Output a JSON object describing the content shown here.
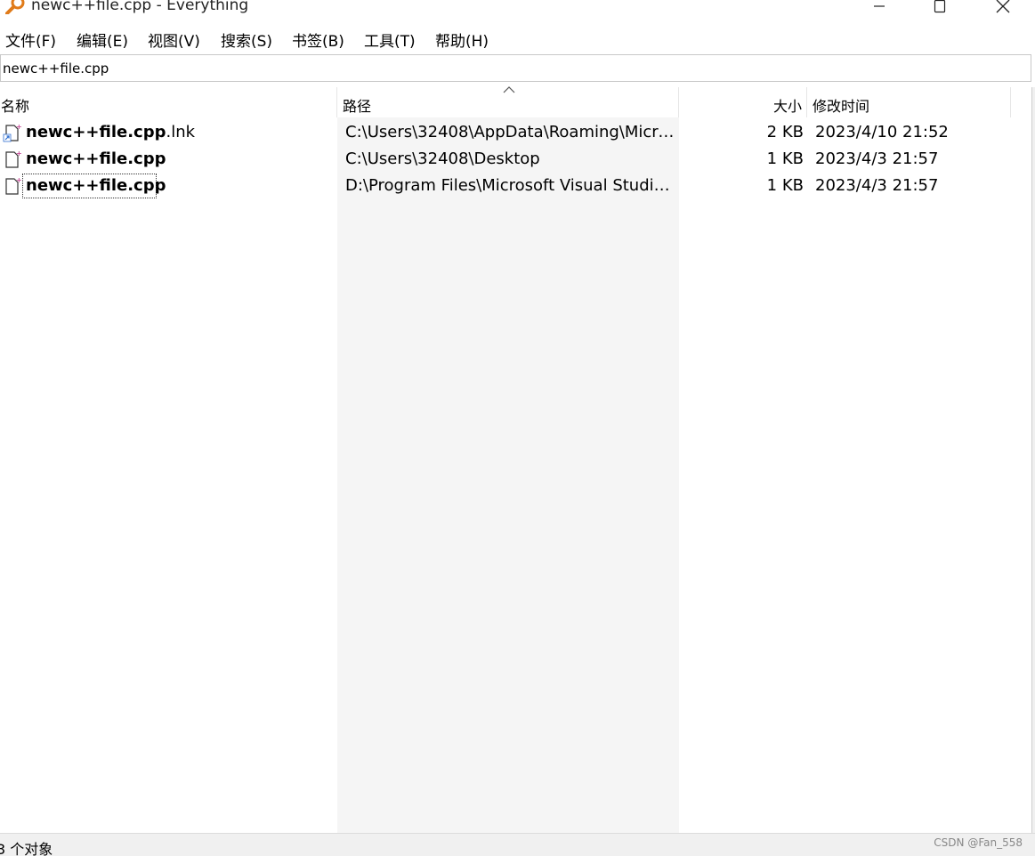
{
  "window": {
    "title": "newc++file.cpp - Everything",
    "app_icon": "magnifier-icon"
  },
  "menu": [
    "文件(F)",
    "编辑(E)",
    "视图(V)",
    "搜索(S)",
    "书签(B)",
    "工具(T)",
    "帮助(H)"
  ],
  "search": {
    "value": "newc++file.cpp"
  },
  "columns": {
    "name": "名称",
    "path": "路径",
    "size": "大小",
    "modified": "修改时间",
    "sorted_by": "path",
    "sort_direction": "ascending"
  },
  "rows": [
    {
      "icon": "shortcut-file-icon",
      "name_bold": "newc++file.cpp",
      "name_ext": ".lnk",
      "path": "C:\\Users\\32408\\AppData\\Roaming\\Micro...",
      "size": "2 KB",
      "modified": "2023/4/10 21:52"
    },
    {
      "icon": "cpp-file-icon",
      "name_bold": "newc++file.cpp",
      "name_ext": "",
      "path": "C:\\Users\\32408\\Desktop",
      "size": "1 KB",
      "modified": "2023/4/3 21:57"
    },
    {
      "icon": "cpp-file-icon",
      "name_bold": "newc++file.cpp",
      "name_ext": "",
      "path": "D:\\Program Files\\Microsoft Visual Studio\\...",
      "size": "1 KB",
      "modified": "2023/4/3 21:57",
      "focused": true
    }
  ],
  "status": {
    "text": "3 个对象"
  },
  "watermark": "CSDN @Fan_558",
  "colors": {
    "path_column_bg": "#f5f5f5",
    "status_bg": "#f0f0f0",
    "icon_accent": "#c8509a",
    "shortcut_arrow": "#2f6fd0",
    "app_icon": "#e07b1a"
  }
}
